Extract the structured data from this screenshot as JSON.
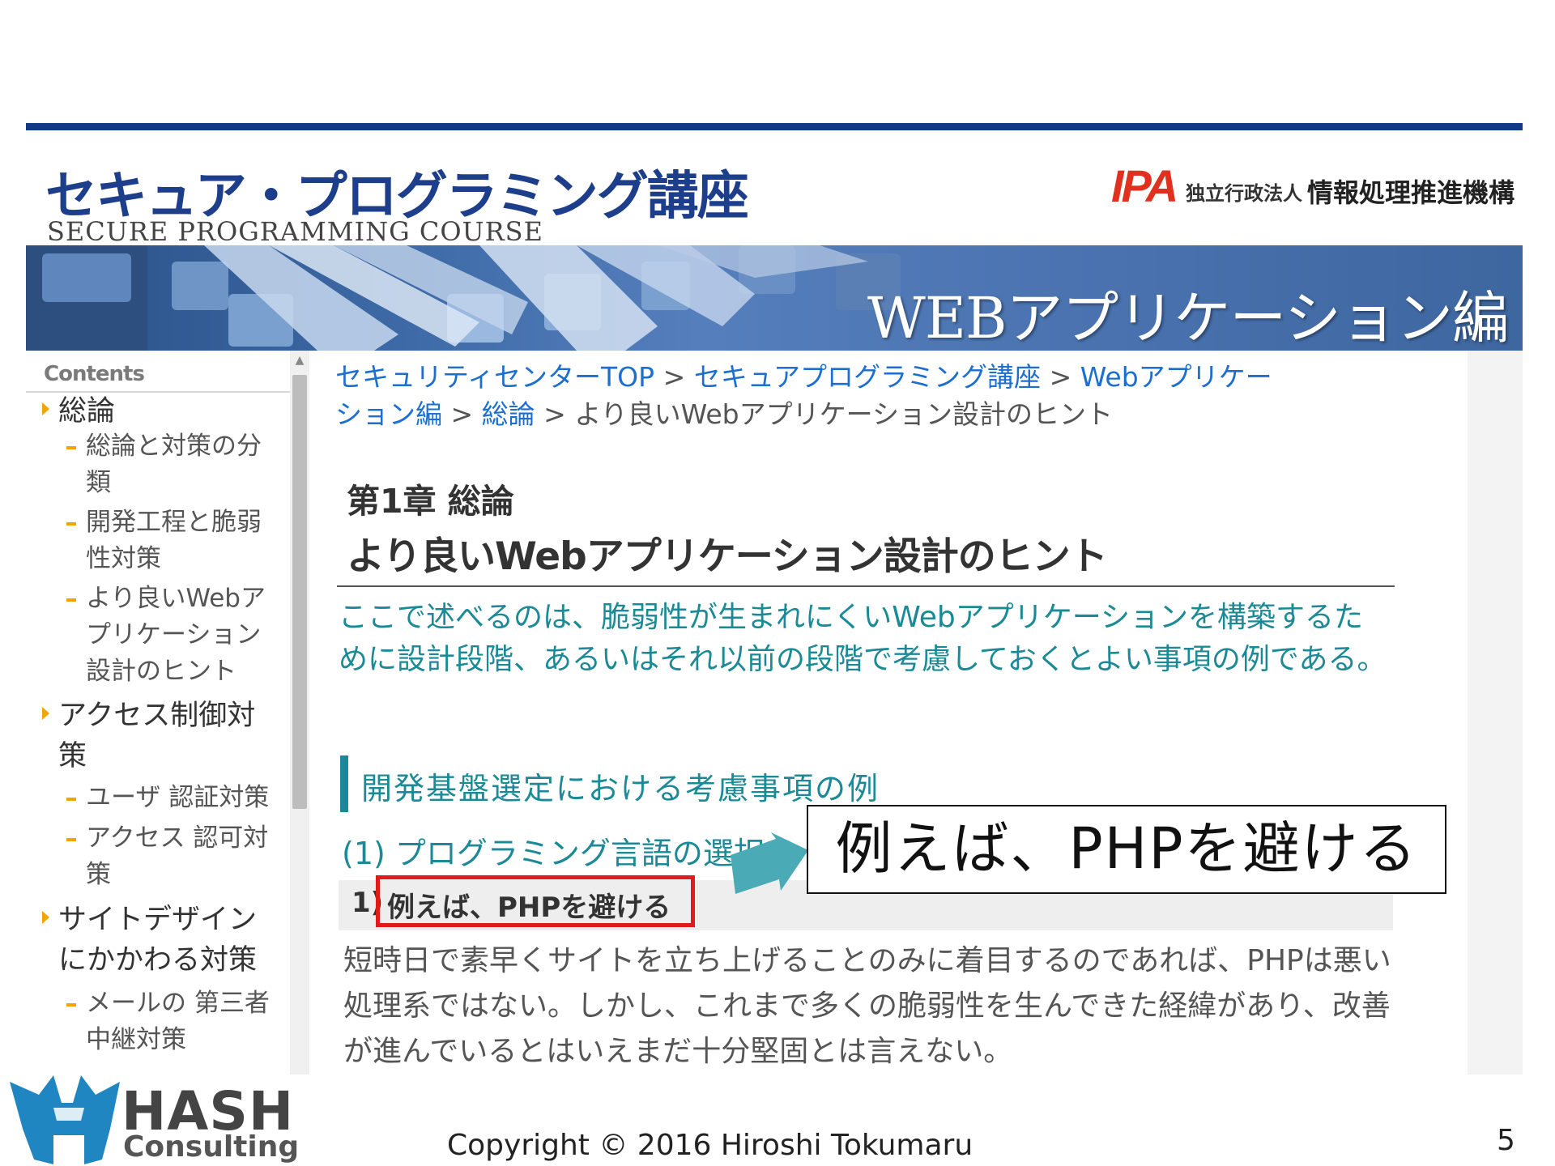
{
  "header": {
    "course_title": "セキュア・プログラミング講座",
    "course_subtitle": "SECURE PROGRAMMING COURSE",
    "ipa_logo": "IPA",
    "ipa_org_type": "独立行政法人",
    "ipa_org_name": "情報処理推進機構",
    "banner_text": "WEBアプリケーション編"
  },
  "sidebar": {
    "contents_label": "Contents",
    "sections": [
      {
        "label": "総論",
        "items": [
          "総論と対策の分類",
          "開発工程と脆弱性対策",
          "より良いWebアプリケーション設計のヒント"
        ]
      },
      {
        "label": "アクセス制御対策",
        "items": [
          "ユーザ 認証対策",
          "アクセス 認可対策"
        ]
      },
      {
        "label": "サイトデザインにかかわる対策",
        "items": [
          "メールの 第三者中継対策"
        ]
      }
    ]
  },
  "breadcrumb": {
    "items": [
      "セキュリティセンターTOP",
      "セキュアプログラミング講座",
      "Webアプリケーション編",
      "総論"
    ],
    "current": "より良いWebアプリケーション設計のヒント",
    "separator": ">"
  },
  "article": {
    "chapter_title": "第1章 総論",
    "page_title": "より良いWebアプリケーション設計のヒント",
    "intro": "ここで述べるのは、脆弱性が生まれにくいWebアプリケーションを構築するために設計段階、あるいはそれ以前の段階で考慮しておくとよい事項の例である。",
    "section_heading": "開発基盤選定における考慮事項の例",
    "sub_heading": "(1) プログラミング言語の選択",
    "point_number": "1)",
    "point_text": "例えば、PHPを避ける",
    "body": "短時日で素早くサイトを立ち上げることのみに着目するのであれば、PHPは悪い処理系ではない。しかし、これまで多くの脆弱性を生んできた経緯があり、改善が進んでいるとはいえまだ十分堅固とは言えない。"
  },
  "callout": {
    "text": "例えば、PHPを避ける"
  },
  "footer": {
    "logo_word": "HASH",
    "logo_sub": "Consulting",
    "copyright": "Copyright © 2016 Hiroshi Tokumaru",
    "page_number": "5"
  },
  "colors": {
    "brand_blue": "#1d3e8a",
    "link_blue": "#1d6fcf",
    "teal": "#1b8a96",
    "highlight_red": "#e11b1b",
    "ipa_red": "#e0311f",
    "nav_marker": "#f0a500"
  }
}
